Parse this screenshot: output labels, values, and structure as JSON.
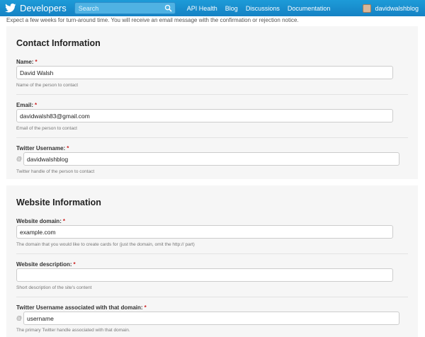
{
  "header": {
    "brand": "Developers",
    "search_placeholder": "Search",
    "nav": [
      "API Health",
      "Blog",
      "Discussions",
      "Documentation"
    ],
    "username": "davidwalshblog",
    "color": "#1d9bd8"
  },
  "intro_text": "Expect a few weeks for turn-around time. You will receive an email message with the confirmation or rejection notice.",
  "contact": {
    "title": "Contact Information",
    "name": {
      "label": "Name:",
      "required": "*",
      "value": "David Walsh",
      "help": "Name of the person to contact"
    },
    "email": {
      "label": "Email:",
      "required": "*",
      "value": "davidwalsh83@gmail.com",
      "help": "Email of the person to contact"
    },
    "twitter": {
      "label": "Twitter Username:",
      "required": "*",
      "prefix": "@",
      "value": "davidwalshblog",
      "help": "Twitter handle of the person to contact"
    }
  },
  "website": {
    "title": "Website Information",
    "domain": {
      "label": "Website domain:",
      "required": "*",
      "value": "example.com",
      "help": "The domain that you would like to create cards for (just the domain, omit the http:// part)"
    },
    "description": {
      "label": "Website description:",
      "required": "*",
      "value": "",
      "help": "Short description of the site's content"
    },
    "twitter": {
      "label": "Twitter Username associated with that domain:",
      "required": "*",
      "prefix": "@",
      "value": "username",
      "help": "The primary Twitter handle associated with that domain."
    }
  }
}
